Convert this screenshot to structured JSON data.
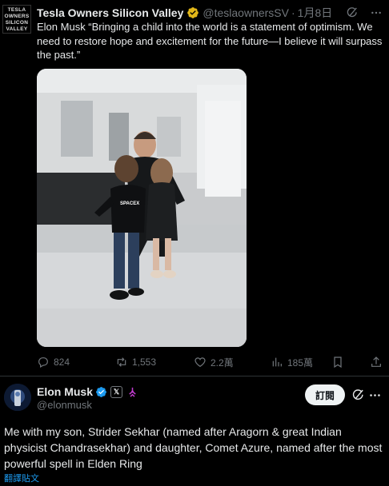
{
  "quoted": {
    "avatar_lines": [
      "TESLA",
      "OWNERS",
      "SILICON",
      "VALLEY"
    ],
    "name": "Tesla Owners Silicon Valley",
    "handle": "@teslaownersSV",
    "separator": "·",
    "date": "1月8日",
    "text": "Elon Musk “Bringing a child into the world is a statement of optimism. We need to restore hope and excitement for the future—I believe it will surpass the past.”",
    "photo_overlay_text": "SPACEX",
    "stats": {
      "replies": "824",
      "reposts": "1,553",
      "likes": "2.2萬",
      "views": "185萬"
    }
  },
  "main": {
    "name": "Elon Musk",
    "x_badge": "𝕏",
    "handle": "@elonmusk",
    "follow_label": "訂閱",
    "text": "Me with my son, Strider Sekhar (named after Aragorn & great Indian physicist Chandrasekhar) and daughter, Comet Azure, named after the most powerful spell in Elden Ring",
    "translate_label": "翻譯貼文"
  },
  "colors": {
    "background": "#000000",
    "text": "#e7e9ea",
    "muted": "#71767b",
    "link": "#1d9bf0",
    "verified_gold": "#e2b719",
    "verified_blue": "#1d9bf0",
    "follow_bg": "#eff3f4"
  },
  "icons": [
    "grok-icon",
    "more-icon",
    "reply-icon",
    "repost-icon",
    "like-icon",
    "views-icon",
    "share-icon",
    "verified-gold-icon",
    "verified-blue-icon",
    "x-icon",
    "spacex-symbol-icon"
  ]
}
